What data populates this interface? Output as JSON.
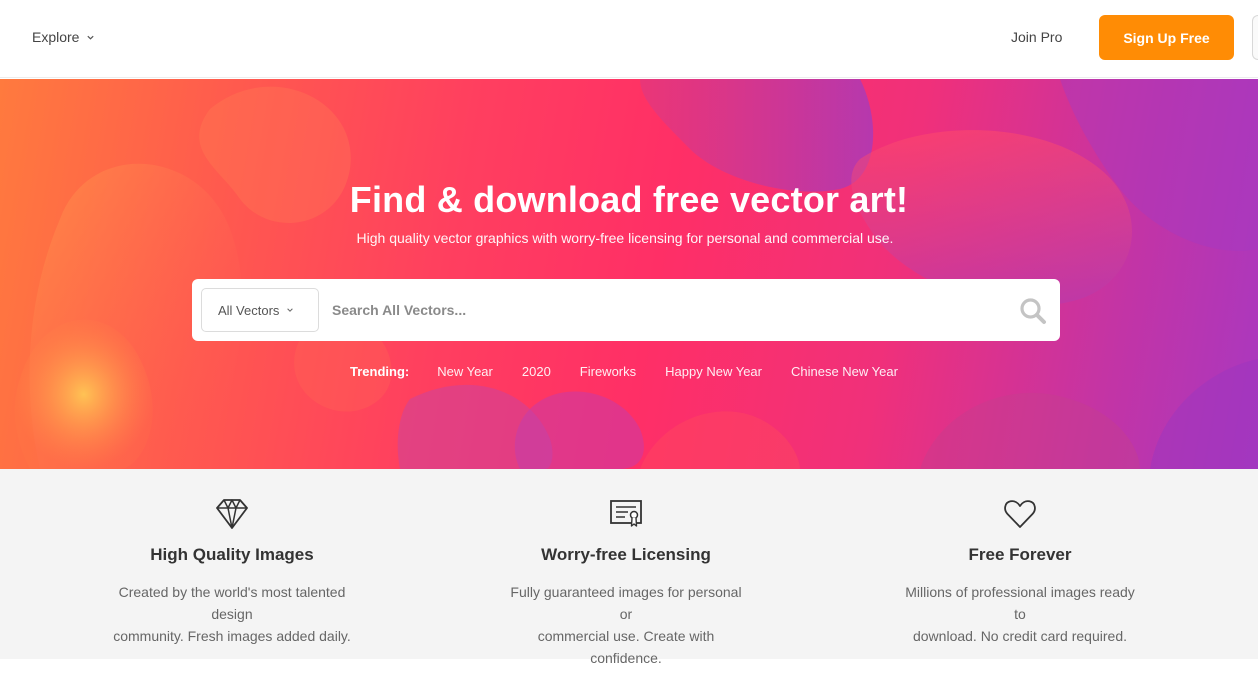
{
  "header": {
    "explore_label": "Explore",
    "join_pro_label": "Join Pro",
    "signup_label": "Sign Up Free"
  },
  "hero": {
    "title": "Find & download free vector art!",
    "subtitle": "High quality vector graphics with worry-free licensing for personal and commercial use.",
    "search": {
      "type_selected": "All Vectors",
      "placeholder": "Search All Vectors..."
    },
    "trending_label": "Trending:",
    "trending_links": [
      "New Year",
      "2020",
      "Fireworks",
      "Happy New Year",
      "Chinese New Year"
    ]
  },
  "features": [
    {
      "icon": "diamond-icon",
      "title": "High Quality Images",
      "desc_line1": "Created by the world's most talented design",
      "desc_line2": "community. Fresh images added daily."
    },
    {
      "icon": "certificate-icon",
      "title": "Worry-free Licensing",
      "desc_line1": "Fully guaranteed images for personal or",
      "desc_line2": "commercial use. Create with confidence."
    },
    {
      "icon": "heart-icon",
      "title": "Free Forever",
      "desc_line1": "Millions of professional images ready to",
      "desc_line2": "download. No credit card required."
    }
  ],
  "colors": {
    "accent": "#ff8c05",
    "hero_start": "#ff7a3e",
    "hero_mid": "#ff2f66",
    "hero_end": "#a938c0",
    "features_bg": "#f4f4f4"
  }
}
